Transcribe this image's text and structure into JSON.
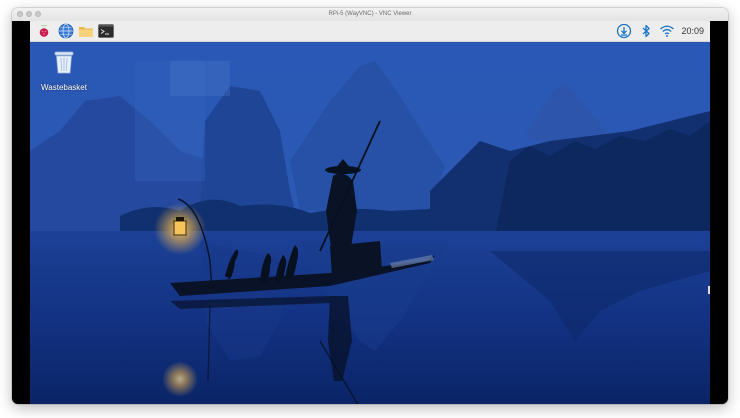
{
  "window": {
    "title": "RPi-5 (WayVNC) - VNC Viewer"
  },
  "panel": {
    "launchers": [
      {
        "icon": "raspberry-pi-menu-icon"
      },
      {
        "icon": "web-browser-globe-icon"
      },
      {
        "icon": "file-manager-folder-icon"
      },
      {
        "icon": "terminal-icon"
      }
    ],
    "tray": [
      {
        "icon": "update-download-icon"
      },
      {
        "icon": "bluetooth-icon"
      },
      {
        "icon": "wifi-icon"
      }
    ],
    "clock": "20:09"
  },
  "desktop": {
    "icons": [
      {
        "label": "Wastebasket",
        "icon": "wastebasket-icon"
      }
    ],
    "wallpaper": "night-river-fisherman-photo"
  },
  "colors": {
    "raspberry": "#c51a4a",
    "tray_blue": "#1a75c9",
    "sky": "#2a58b6",
    "water": "#0b2a6e"
  }
}
